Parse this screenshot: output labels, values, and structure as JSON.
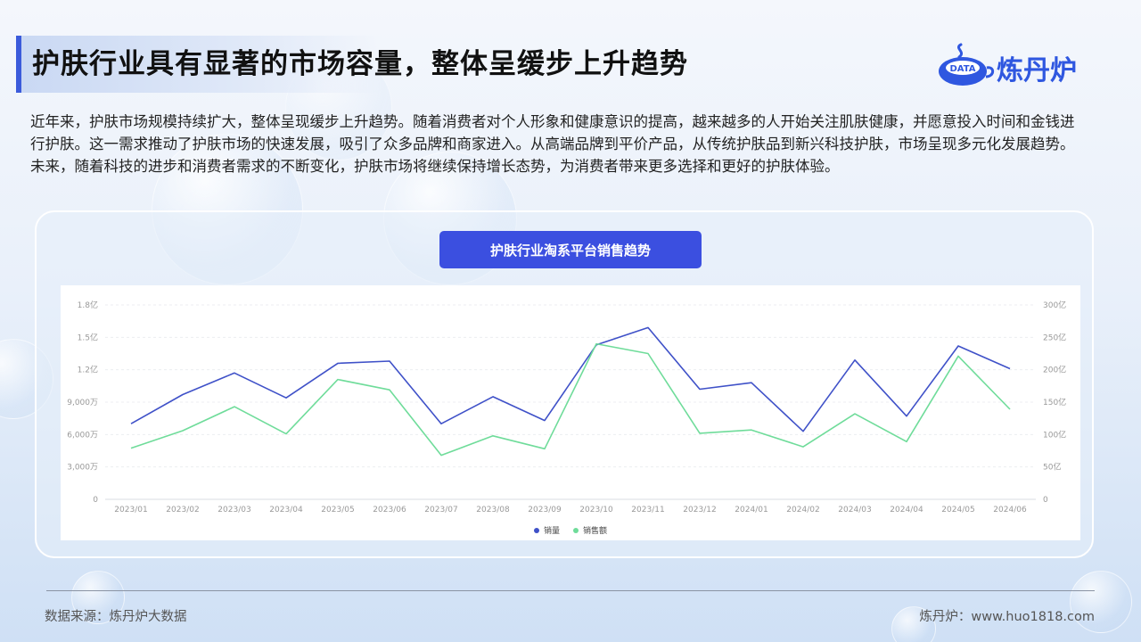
{
  "page": {
    "title": "护肤行业具有显著的市场容量，整体呈缓步上升趋势",
    "intro": "近年来，护肤市场规模持续扩大，整体呈现缓步上升趋势。随着消费者对个人形象和健康意识的提高，越来越多的人开始关注肌肤健康，并愿意投入时间和金钱进行护肤。这一需求推动了护肤市场的快速发展，吸引了众多品牌和商家进入。从高端品牌到平价产品，从传统护肤品到新兴科技护肤，市场呈现多元化发展趋势。未来，随着科技的进步和消费者需求的不断变化，护肤市场将继续保持增长态势，为消费者带来更多选择和更好的护肤体验。",
    "footer_source": "数据来源：炼丹炉大数据",
    "footer_site": "炼丹炉：www.huo1818.com"
  },
  "logo": {
    "text": "炼丹炉",
    "badge": "DATA",
    "color": "#2f57e0",
    "icon": "cauldron-icon"
  },
  "chart_data": {
    "type": "line",
    "title": "护肤行业淘系平台销售趋势",
    "categories": [
      "2023/01",
      "2023/02",
      "2023/03",
      "2023/04",
      "2023/05",
      "2023/06",
      "2023/07",
      "2023/08",
      "2023/09",
      "2023/10",
      "2023/11",
      "2023/12",
      "2024/01",
      "2024/02",
      "2024/03",
      "2024/04",
      "2024/05",
      "2024/06"
    ],
    "y_left": {
      "ticks": [
        "0",
        "3,000万",
        "6,000万",
        "9,000万",
        "1.2亿",
        "1.5亿",
        "1.8亿"
      ],
      "ylim": [
        0,
        180000000
      ]
    },
    "y_right": {
      "ticks": [
        "0",
        "50亿",
        "100亿",
        "150亿",
        "200亿",
        "250亿",
        "300亿"
      ],
      "ylim": [
        0,
        30000000000
      ]
    },
    "series": [
      {
        "name": "销量",
        "axis": "left",
        "color": "#3f51c8",
        "values": [
          70000000,
          97000000,
          117000000,
          94000000,
          126000000,
          128000000,
          70000000,
          95000000,
          73000000,
          143000000,
          159000000,
          102000000,
          108000000,
          63000000,
          129000000,
          77000000,
          142000000,
          121000000
        ]
      },
      {
        "name": "销售额",
        "axis": "right",
        "color": "#6fdc9a",
        "values": [
          7900000000,
          10600000000,
          14300000000,
          10100000000,
          18500000000,
          16900000000,
          6800000000,
          9800000000,
          7800000000,
          24000000000,
          22500000000,
          10200000000,
          10700000000,
          8100000000,
          13200000000,
          8900000000,
          22100000000,
          13900000000
        ]
      }
    ],
    "grid": true,
    "legend": "bottom-center"
  }
}
